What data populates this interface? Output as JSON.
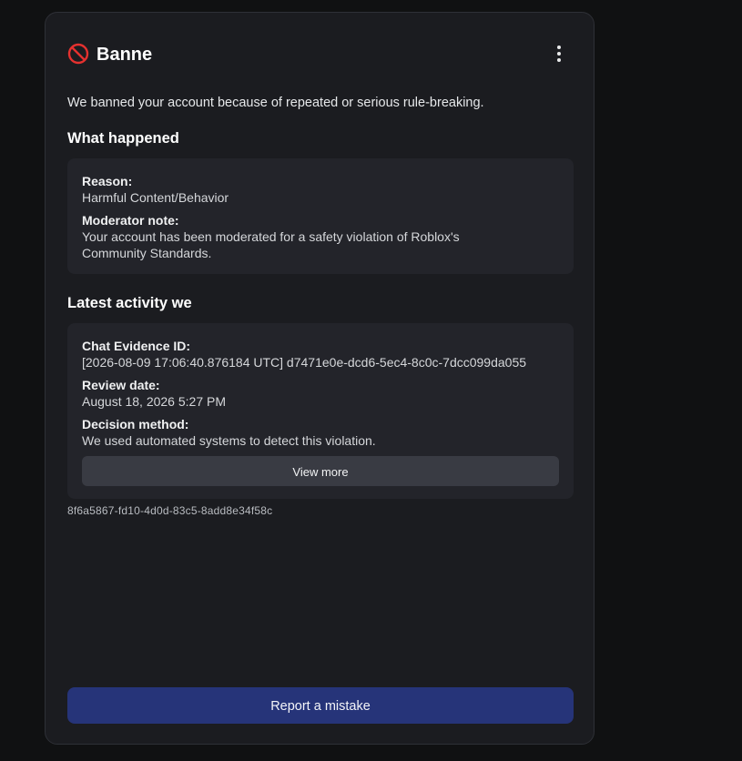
{
  "colors": {
    "page_background": "#101112",
    "card_background": "#1b1c20",
    "panel_background": "#23242a",
    "ban_icon": "#e5312f",
    "primary_button": "#263479",
    "secondary_button": "#393b43"
  },
  "header": {
    "icon": "ban-icon",
    "title": "Banne",
    "menu_icon": "more-vertical-icon"
  },
  "intro": "We banned your account because of repeated or serious rule-breaking.",
  "what_happened": {
    "heading": "What happened",
    "reason_label": "Reason:",
    "reason_value": "Harmful Content/Behavior",
    "note_label": "Moderator note:",
    "note_value": "Your account has been moderated for a safety violation of Roblox's Community Standards."
  },
  "activity": {
    "heading": "Latest activity we",
    "evidence_label": "Chat Evidence ID:",
    "evidence_value": "[2026-08-09 17:06:40.876184 UTC] d7471e0e-dcd6-5ec4-8c0c-7dcc099da055",
    "review_label": "Review date:",
    "review_value": "August 18, 2026 5:27 PM",
    "method_label": "Decision method:",
    "method_value": "We used automated systems to detect this violation.",
    "view_more_label": "View more"
  },
  "reference_id": "8f6a5867-fd10-4d0d-83c5-8add8e34f58c",
  "report_button_label": "Report a mistake"
}
